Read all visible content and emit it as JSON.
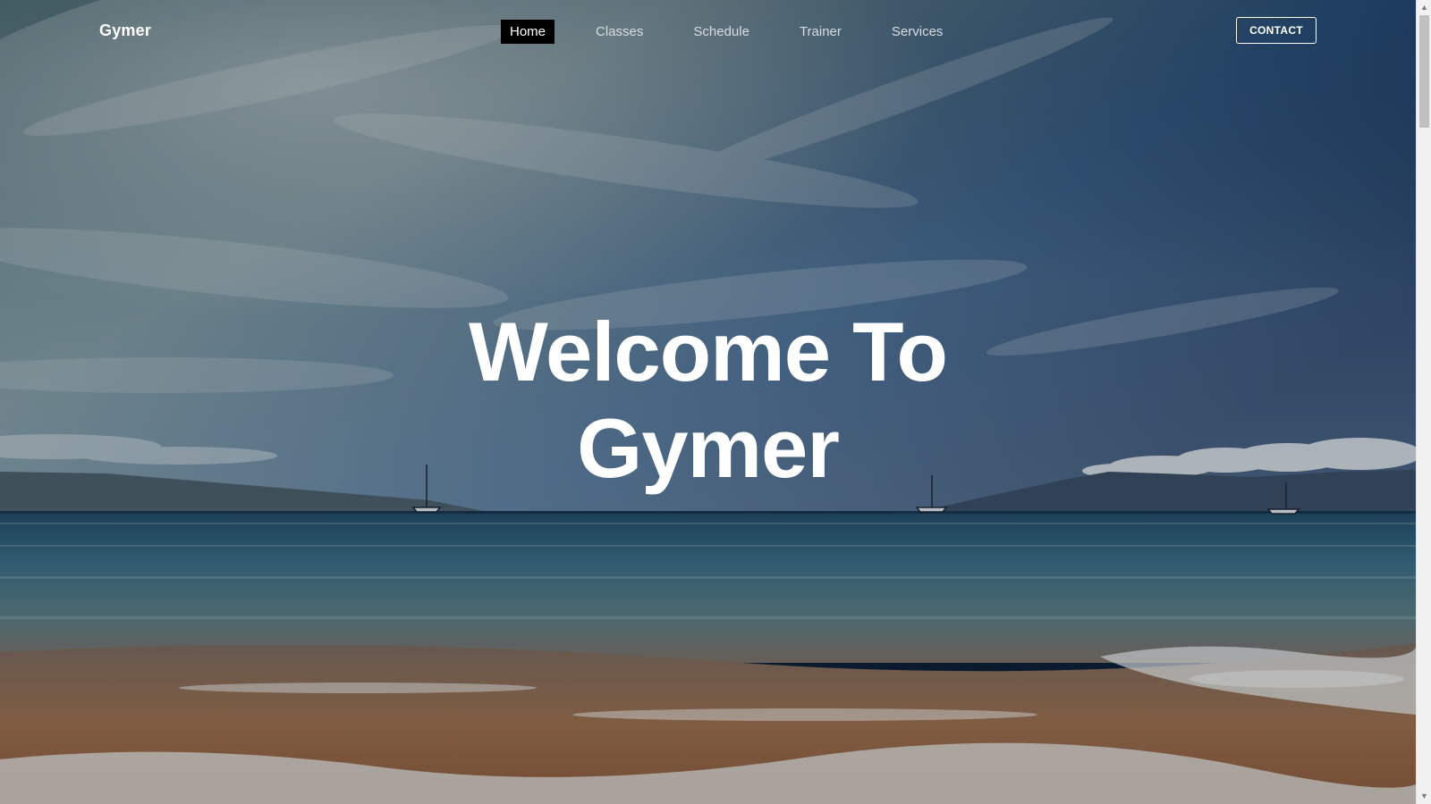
{
  "brand": {
    "name": "Gymer"
  },
  "nav": {
    "items": [
      {
        "label": "Home",
        "active": true
      },
      {
        "label": "Classes",
        "active": false
      },
      {
        "label": "Schedule",
        "active": false
      },
      {
        "label": "Trainer",
        "active": false
      },
      {
        "label": "Services",
        "active": false
      }
    ],
    "contact_label": "CONTACT"
  },
  "hero": {
    "line1": "Welcome To",
    "line2": "Gymer",
    "background": "beach-ocean-sky-image"
  },
  "colors": {
    "active_nav_bg": "#000000",
    "text": "#ffffff",
    "sky_top": "#1d3d63",
    "sea": "#2c5a73",
    "sand": "#9a6a45"
  }
}
